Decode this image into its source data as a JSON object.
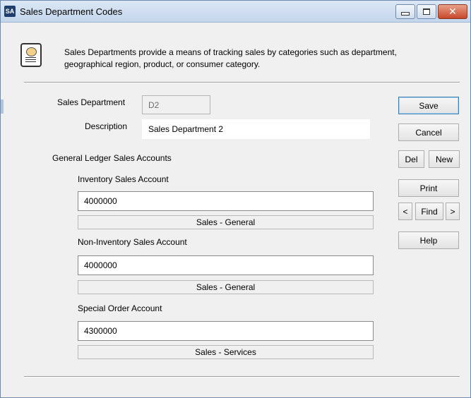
{
  "window": {
    "app_icon_text": "SA",
    "title": "Sales Department Codes",
    "controls": {
      "minimize": "minimize",
      "maximize": "maximize",
      "close": "✕"
    }
  },
  "info": {
    "line1": "Sales Departments provide a means of tracking sales by categories such as department,",
    "line2": "geographical region, product, or consumer category."
  },
  "form": {
    "sales_department_label": "Sales Department",
    "sales_department_value": "D2",
    "description_label": "Description",
    "description_value": "Sales Department 2",
    "gl_section_label": "General Ledger Sales Accounts",
    "inventory_label": "Inventory Sales Account",
    "inventory_value": "4000000",
    "inventory_desc": "Sales - General",
    "noninventory_label": "Non-Inventory Sales Account",
    "noninventory_value": "4000000",
    "noninventory_desc": "Sales - General",
    "special_label": "Special Order Account",
    "special_value": "4300000",
    "special_desc": "Sales - Services"
  },
  "buttons": {
    "save": "Save",
    "cancel": "Cancel",
    "del": "Del",
    "new": "New",
    "print": "Print",
    "prev": "<",
    "find": "Find",
    "next": ">",
    "help": "Help"
  }
}
